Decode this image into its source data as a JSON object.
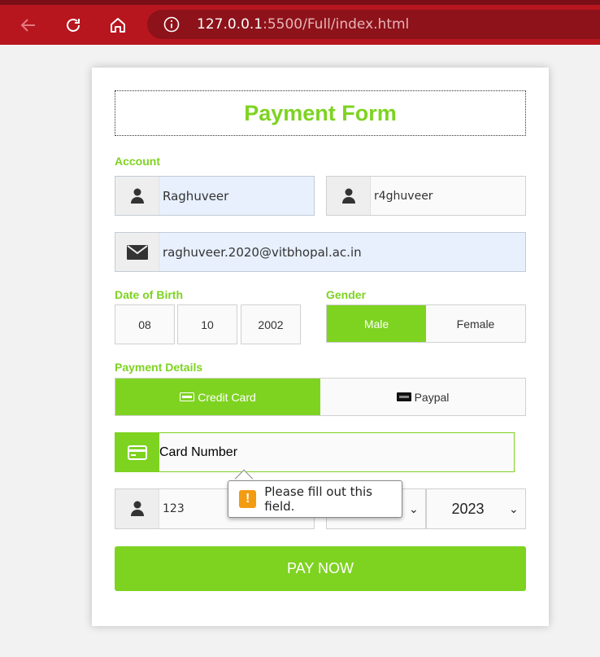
{
  "browser": {
    "url_host": "127.0.0.1",
    "url_rest": ":5500/Full/index.html"
  },
  "form": {
    "title": "Payment Form",
    "account_label": "Account",
    "first_name_value": "Raghuveer",
    "username_value": "r4ghuveer",
    "email_value": "raghuveer.2020@vitbhopal.ac.in",
    "dob_label": "Date of Birth",
    "dob_day": "08",
    "dob_month": "10",
    "dob_year": "2002",
    "gender_label": "Gender",
    "gender_male": "Male",
    "gender_female": "Female",
    "payment_label": "Payment Details",
    "method_credit": "Credit Card",
    "method_paypal": "Paypal",
    "card_number_placeholder": "Card Number",
    "cvv_value": "123",
    "exp_year_value": "2023",
    "pay_button": "PAY NOW",
    "validation_message": "Please fill out this field."
  },
  "colors": {
    "accent": "#7ed321",
    "browser": "#b8161f",
    "warning": "#f39c12"
  }
}
